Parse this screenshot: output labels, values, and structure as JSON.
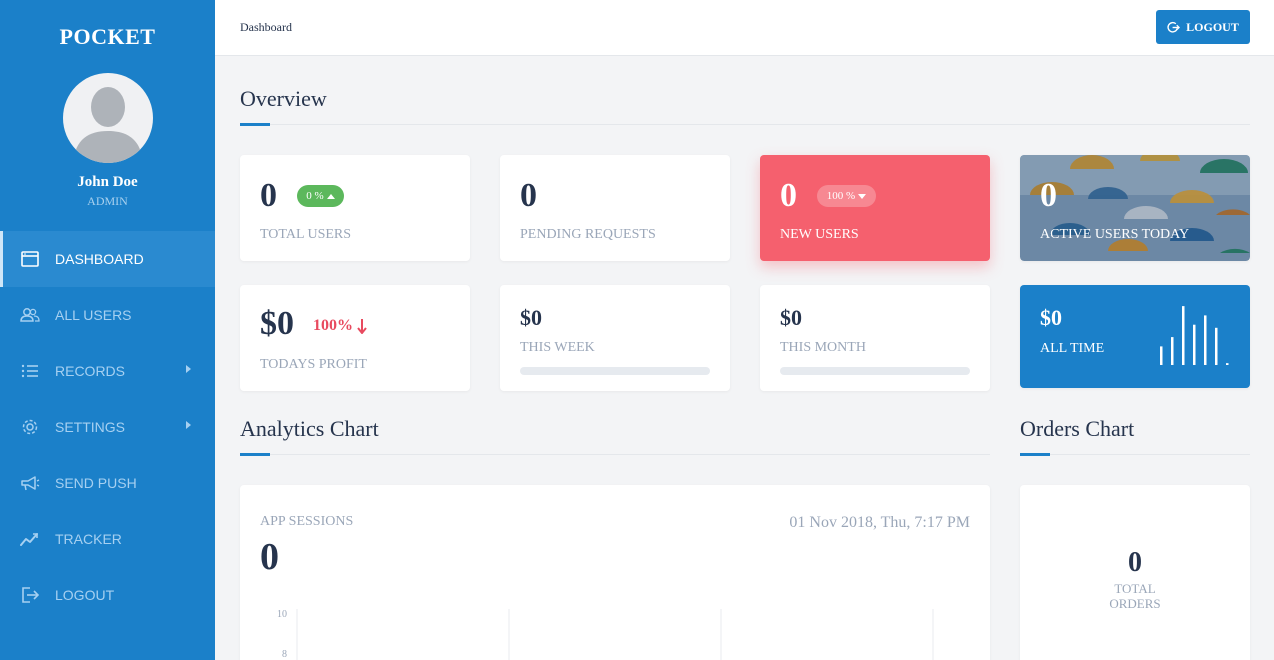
{
  "sidebar": {
    "brand": "POCKET",
    "user": {
      "name": "John Doe",
      "role": "ADMIN"
    },
    "items": [
      {
        "label": "DASHBOARD",
        "icon": "window-icon",
        "active": true
      },
      {
        "label": "ALL USERS",
        "icon": "users-icon"
      },
      {
        "label": "RECORDS",
        "icon": "list-icon",
        "has_submenu": true
      },
      {
        "label": "SETTINGS",
        "icon": "gear-icon",
        "has_submenu": true
      },
      {
        "label": "SEND PUSH",
        "icon": "megaphone-icon"
      },
      {
        "label": "TRACKER",
        "icon": "trend-icon"
      },
      {
        "label": "LOGOUT",
        "icon": "logout-icon"
      }
    ]
  },
  "topbar": {
    "breadcrumb": "Dashboard",
    "logout_label": "LOGOUT"
  },
  "overview": {
    "title": "Overview",
    "cards": [
      {
        "value": "0",
        "label": "TOTAL USERS",
        "badge": "0 %",
        "badge_trend": "up",
        "badge_color": "#5cb85c"
      },
      {
        "value": "0",
        "label": "PENDING REQUESTS"
      },
      {
        "value": "0",
        "label": "NEW USERS",
        "badge": "100 %",
        "badge_trend": "down",
        "bg_color": "#f5606e"
      },
      {
        "value": "0",
        "label": "ACTIVE USERS TODAY"
      }
    ],
    "profit_cards": [
      {
        "value": "$0",
        "label": "TODAYS PROFIT",
        "change": "100%",
        "change_trend": "down",
        "change_color": "#e84a5f"
      },
      {
        "value": "$0",
        "label": "THIS WEEK",
        "progress": 0
      },
      {
        "value": "$0",
        "label": "THIS MONTH",
        "progress": 0
      },
      {
        "value": "$0",
        "label": "ALL TIME",
        "bg_color": "#1b80c9",
        "sparkline": [
          0.3,
          0.45,
          0.95,
          0.65,
          0.8,
          0.6,
          0.03
        ]
      }
    ]
  },
  "analytics": {
    "title": "Analytics Chart",
    "label": "APP SESSIONS",
    "value": "0",
    "timestamp": "01 Nov 2018, Thu, 7:17 PM"
  },
  "orders": {
    "title": "Orders Chart",
    "value": "0",
    "label_line1": "TOTAL",
    "label_line2": "ORDERS"
  },
  "chart_data": {
    "type": "line",
    "title": "",
    "ylabel": "",
    "xlabel": "",
    "y_ticks": [
      10,
      8
    ],
    "ylim": [
      0,
      10
    ],
    "series": [
      {
        "values": []
      }
    ],
    "grid": true
  }
}
